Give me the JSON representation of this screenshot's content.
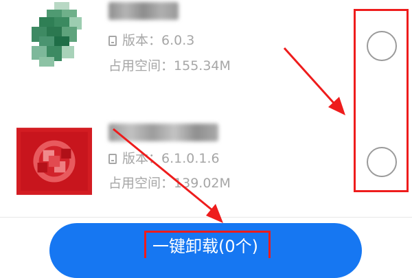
{
  "apps": [
    {
      "version_label": "版本：",
      "version": "6.0.3",
      "space_label": "占用空间：",
      "space": "155.34M",
      "icon": "green-app-icon",
      "selected": false
    },
    {
      "version_label": "版本：",
      "version": "6.1.0.1.6",
      "space_label": "占用空间：",
      "space": "139.02M",
      "icon": "red-app-icon",
      "selected": false
    }
  ],
  "uninstall_button": {
    "label": "一键卸载(0个)"
  },
  "colors": {
    "accent": "#1677f2",
    "annotation": "#ee1c1c",
    "meta_text": "#a6a6a6"
  }
}
